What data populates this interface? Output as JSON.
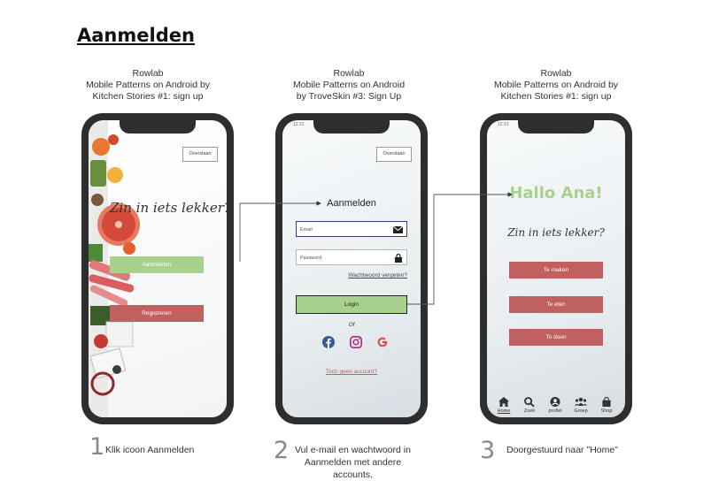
{
  "page": {
    "title": "Aanmelden"
  },
  "phones": [
    {
      "caption": [
        "Rowlab",
        "Mobile Patterns on Android by",
        "Kitchen Stories #1: sign up"
      ],
      "top_button": "Overslaan",
      "tagline": "Zin in iets lekker?",
      "primary_button": "Aanmelden",
      "secondary_button": "Registreren",
      "step_number": "1",
      "step_text": [
        "Klik icoon Aanmelden"
      ]
    },
    {
      "caption": [
        "Rowlab",
        "Mobile Patterns on Android",
        "by TroveSkin #3: Sign Up"
      ],
      "status_time": "12:21",
      "top_button": "Overslaan",
      "heading": "Aanmelden",
      "email_placeholder": "Email",
      "password_placeholder": "Password",
      "forgot_link": "Wachtwoord vergeten?",
      "login_button": "Login",
      "or_text": "Of",
      "social_icons": [
        "facebook-icon",
        "instagram-icon",
        "google-icon"
      ],
      "no_account_link": "Toch geen account?",
      "step_number": "2",
      "step_text": [
        "Vul e-mail en wachtwoord in",
        "Aanmelden met andere",
        "accounts."
      ]
    },
    {
      "caption": [
        "Rowlab",
        "Mobile Patterns on Android by",
        "Kitchen Stories #1: sign up"
      ],
      "status_time": "12:21",
      "greeting": "Hallo Ana!",
      "tagline": "Zin in iets lekker?",
      "buttons": [
        "Te maken",
        "Te eten",
        "To doen"
      ],
      "nav": [
        {
          "label": "Home",
          "icon": "home-icon"
        },
        {
          "label": "Zoek",
          "icon": "search-icon"
        },
        {
          "label": "profiel",
          "icon": "profile-icon"
        },
        {
          "label": "Groep",
          "icon": "group-icon"
        },
        {
          "label": "Shop",
          "icon": "bag-icon"
        }
      ],
      "step_number": "3",
      "step_text": [
        "Doorgestuurd naar \"Home\""
      ]
    }
  ],
  "colors": {
    "accent_green": "#a9d18e",
    "accent_red": "#c0605f",
    "greeting_green": "#a9d18e",
    "phone_frame": "#2e2e2e"
  }
}
